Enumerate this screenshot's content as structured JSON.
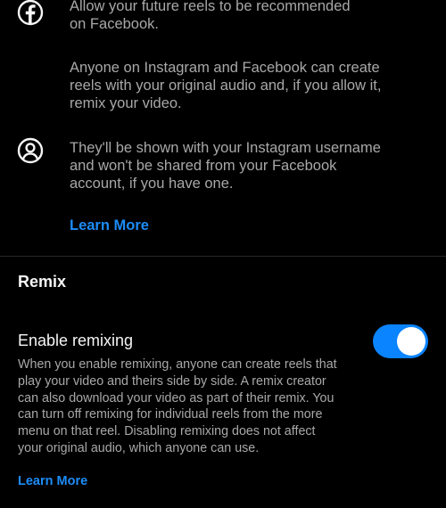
{
  "info": {
    "facebook_text": "Allow your future reels to be recommended\non Facebook.",
    "audio_text": "Anyone on Instagram and Facebook can create\nreels with your original audio and, if you allow it,\nremix your video.",
    "profile_text": "They'll be shown with your Instagram username\nand won't be shared from your Facebook\naccount, if you have one.",
    "learn_more": "Learn More"
  },
  "remix": {
    "section_title": "Remix",
    "toggle_label": "Enable remixing",
    "toggle_on": true,
    "description": "When you enable remixing, anyone can create reels that\nplay your video and theirs side by side. A remix creator\ncan also download your video as part of their remix. You\ncan turn off remixing for individual reels from the more\nmenu on that reel. Disabling remixing does not affect\nyour original audio, which anyone can use.",
    "learn_more": "Learn More"
  },
  "colors": {
    "background": "#000000",
    "link": "#1d8cf7",
    "toggle_on": "#0a84ff",
    "secondary_text": "#a8a8a8"
  },
  "icons": {
    "facebook": "facebook-icon",
    "profile": "profile-icon"
  }
}
